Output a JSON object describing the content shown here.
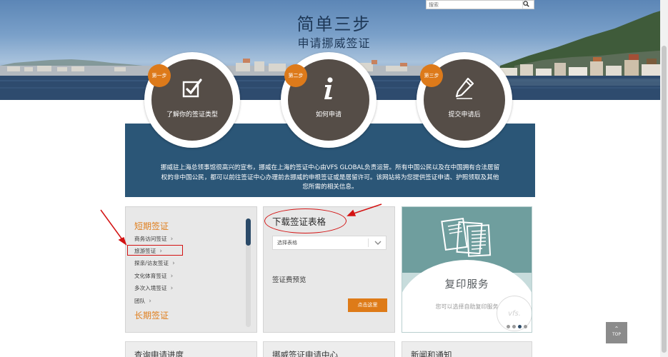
{
  "hero": {
    "title": "简单三步",
    "subtitle": "申请挪威签证"
  },
  "search": {
    "placeholder": "搜索",
    "button_icon": "search-icon"
  },
  "steps": [
    {
      "badge": "第一步",
      "label": "了解你的签证类型",
      "icon": "checkbox-icon"
    },
    {
      "badge": "第二步",
      "label": "如何申请",
      "icon": "info-icon"
    },
    {
      "badge": "第三步",
      "label": "提交申请后",
      "icon": "pencil-icon"
    }
  ],
  "intro": {
    "text": "挪威驻上海总领事馆很高兴的宣布，挪威在上海的签证中心由VFS GLOBAL负责运营。所有中国公民以及在中国拥有合法居留权的非中国公民，都可以前往签证中心办理前去挪威的申根签证或是居留许可。该网站将为您提供签证申请、护照领取及其他您所需的相关信息。"
  },
  "visa_panel": {
    "short_heading": "短期签证",
    "items": [
      "商务访问签证",
      "旅游签证",
      "探亲/访友签证",
      "文化体育签证",
      "多次入境签证",
      "团队"
    ],
    "long_heading": "长期签证"
  },
  "forms_panel": {
    "heading": "下载签证表格",
    "select_placeholder": "选择表格",
    "fee_label": "签证费预览",
    "button": "点击这里"
  },
  "photo_panel": {
    "title": "复印服务",
    "description": "您可以选择自助复印服务",
    "stamp": "vfs.",
    "carousel_total": 4,
    "carousel_active": 3
  },
  "top_button": "TOP",
  "bottom_panels": [
    "查询申请进度",
    "挪威签证申请中心",
    "新闻和通知"
  ],
  "colors": {
    "accent_orange": "#dd7a1a",
    "navy": "#2b5677",
    "highlight_red": "#d31212",
    "step_circle": "#554d47"
  }
}
